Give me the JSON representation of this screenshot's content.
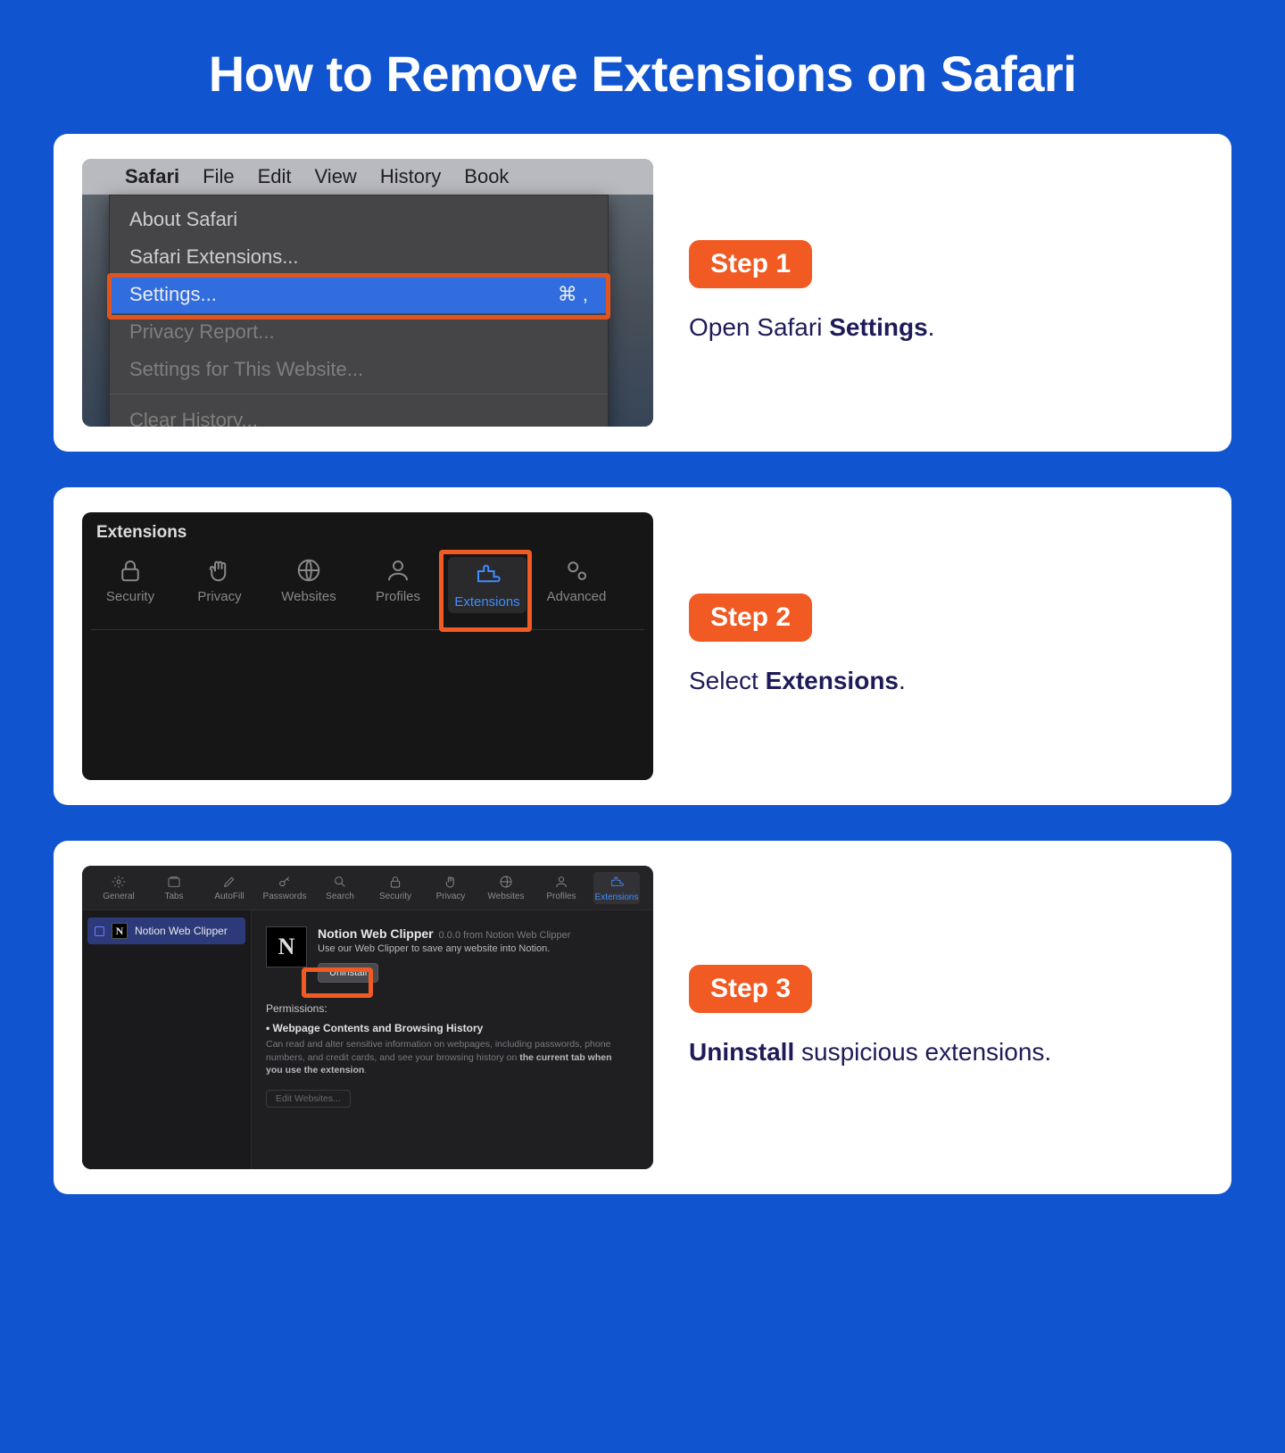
{
  "page_title": "How to Remove Extensions on Safari",
  "steps": [
    {
      "badge": "Step 1",
      "desc_prefix": "Open Safari ",
      "desc_bold": "Settings",
      "desc_suffix": "."
    },
    {
      "badge": "Step 2",
      "desc_prefix": "Select ",
      "desc_bold": "Extensions",
      "desc_suffix": "."
    },
    {
      "badge": "Step 3",
      "desc_bold": "Uninstall",
      "desc_suffix": " suspicious extensions."
    }
  ],
  "shot1": {
    "menubar": [
      "Safari",
      "File",
      "Edit",
      "View",
      "History",
      "Book"
    ],
    "items": [
      {
        "label": "About Safari"
      },
      {
        "label": "Safari Extensions..."
      },
      {
        "label": "Settings...",
        "shortcut": "⌘ ,",
        "selected": true
      },
      {
        "label": "Privacy Report...",
        "dim": true
      },
      {
        "label": "Settings for This Website...",
        "dim": true
      },
      {
        "label": "Clear History...",
        "dim": true
      }
    ]
  },
  "shot2": {
    "title": "Extensions",
    "tabs": [
      "Security",
      "Privacy",
      "Websites",
      "Profiles",
      "Extensions",
      "Advanced"
    ]
  },
  "shot3": {
    "top_tabs": [
      "General",
      "Tabs",
      "AutoFill",
      "Passwords",
      "Search",
      "Security",
      "Privacy",
      "Websites",
      "Profiles",
      "Extensions"
    ],
    "side_item": "Notion Web Clipper",
    "ext_title": "Notion Web Clipper",
    "ext_ver": "0.0.0 from Notion Web Clipper",
    "ext_sub": "Use our Web Clipper to save any website into Notion.",
    "uninstall": "Uninstall",
    "perm_label": "Permissions:",
    "perm_item": "Webpage Contents and Browsing History",
    "perm_det_a": "Can read and alter sensitive information on webpages, including passwords, phone numbers, and credit cards, and see your browsing history on ",
    "perm_det_b": "the current tab when you use the extension",
    "perm_det_c": ".",
    "edit_websites": "Edit Websites..."
  }
}
